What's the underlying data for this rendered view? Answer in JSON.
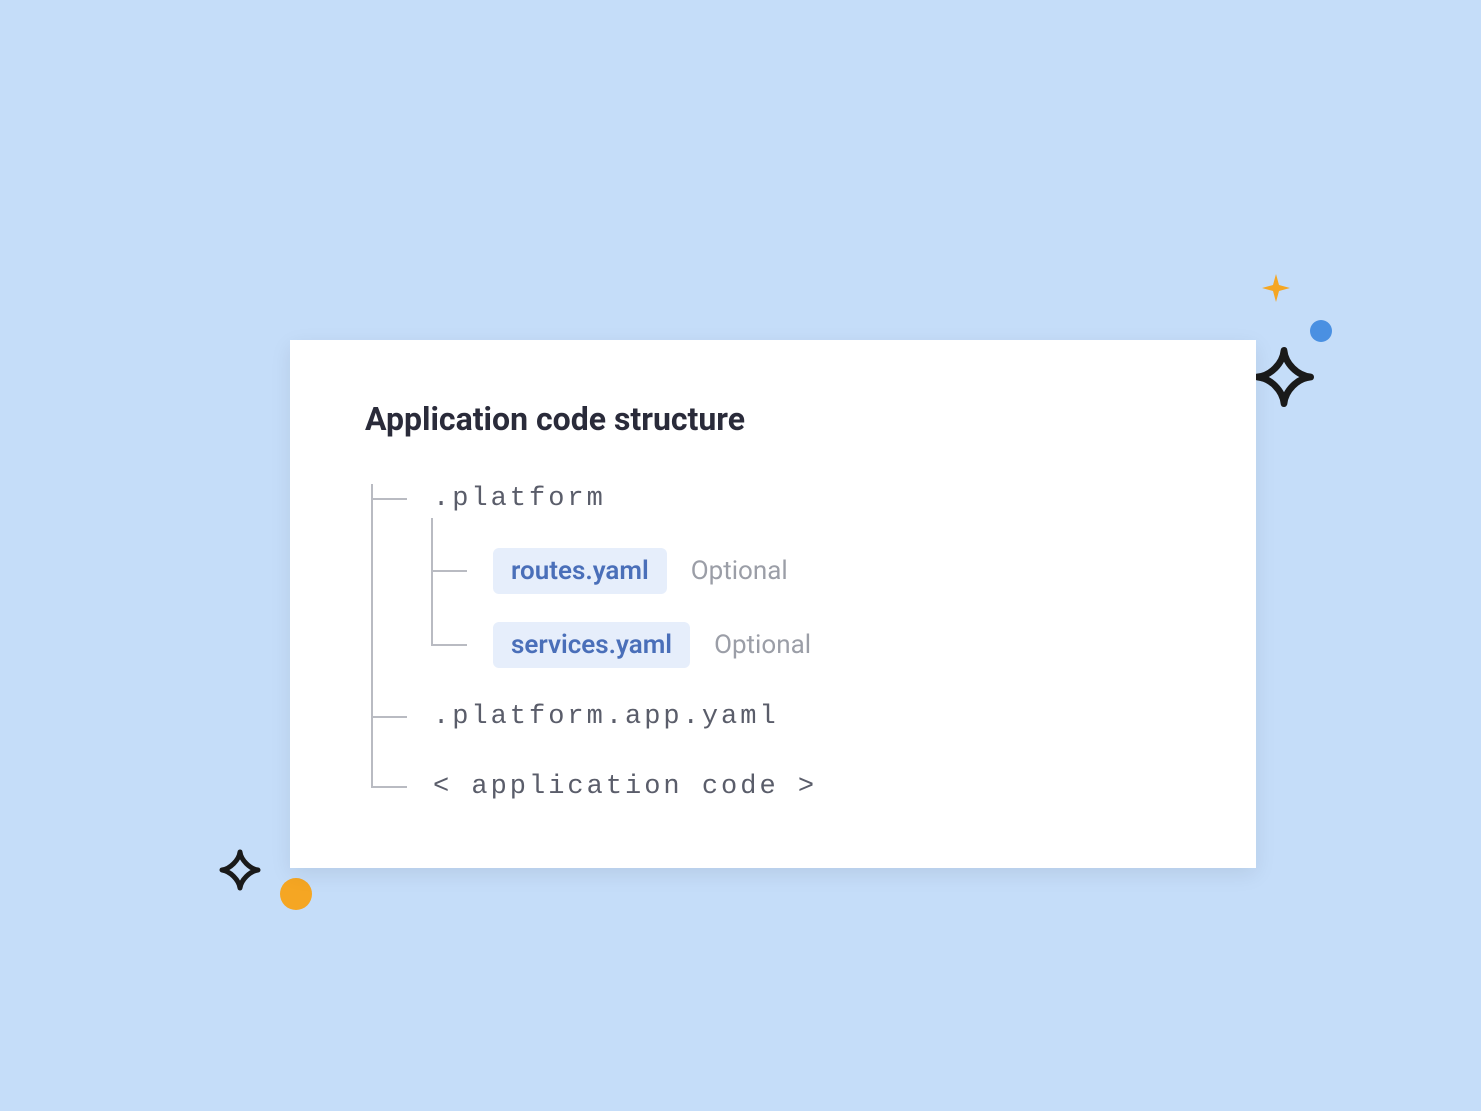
{
  "card": {
    "title": "Application code structure",
    "tree": {
      "platform_dir": ".platform",
      "routes_file": "routes.yaml",
      "routes_note": "Optional",
      "services_file": "services.yaml",
      "services_note": "Optional",
      "app_yaml": ".platform.app.yaml",
      "app_code": "< application code >"
    }
  },
  "colors": {
    "background": "#c5ddf9",
    "card_bg": "#ffffff",
    "title": "#2a2b3a",
    "tree_text": "#5a5d6a",
    "pill_bg": "#e6eefb",
    "pill_text": "#4a6fb9",
    "note_text": "#9b9ea7",
    "orange": "#f5a623",
    "blue": "#4a90e2",
    "black": "#1a1a1a"
  }
}
